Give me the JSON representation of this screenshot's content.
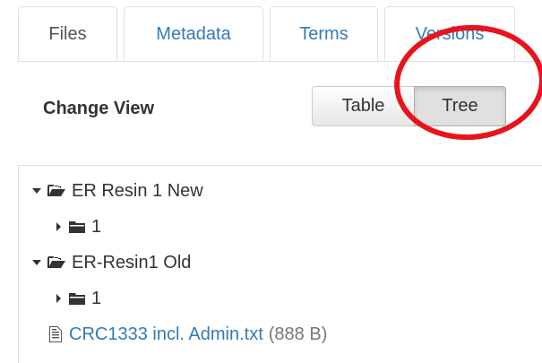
{
  "tabs": [
    {
      "label": "Files",
      "active": true
    },
    {
      "label": "Metadata",
      "active": false
    },
    {
      "label": "Terms",
      "active": false
    },
    {
      "label": "Versions",
      "active": false
    }
  ],
  "view_switcher": {
    "label": "Change View",
    "options": [
      "Table",
      "Tree"
    ],
    "selected": "Tree"
  },
  "tree": {
    "nodes": [
      {
        "label": "ER Resin 1 New",
        "type": "folder",
        "expanded": true
      },
      {
        "label": "1",
        "type": "folder",
        "expanded": false
      },
      {
        "label": "ER-Resin1 Old",
        "type": "folder",
        "expanded": true
      },
      {
        "label": "1",
        "type": "folder",
        "expanded": false
      },
      {
        "label": "CRC1333 incl. Admin.txt",
        "type": "file",
        "size": "(888 B)"
      }
    ]
  },
  "colors": {
    "link": "#337ab7",
    "highlight_ring": "#e8141c",
    "border": "#dddddd"
  }
}
